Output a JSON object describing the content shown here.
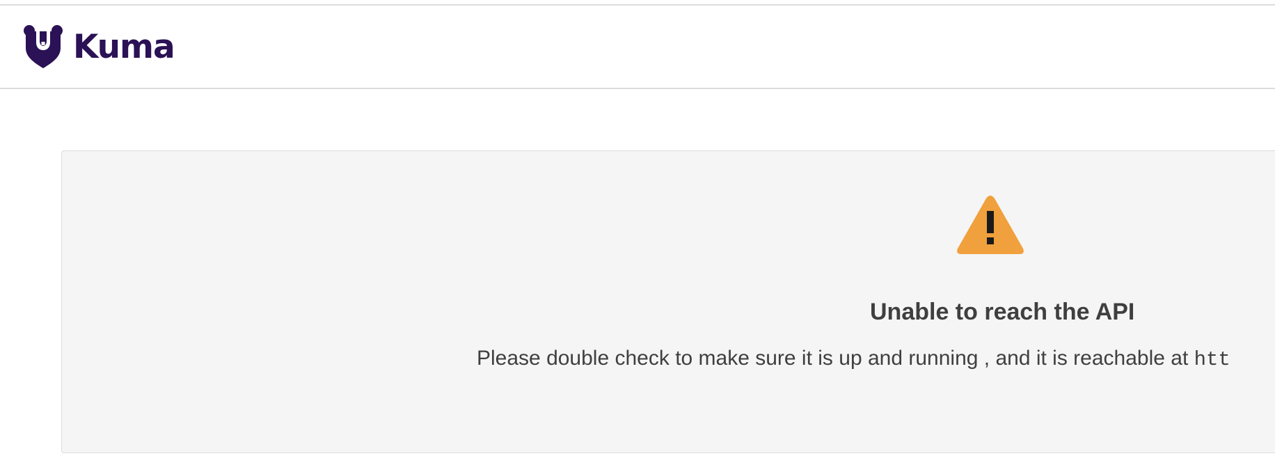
{
  "header": {
    "brand": "Kuma",
    "logo_icon": "bear-logo-icon",
    "brand_color": "#2b1155"
  },
  "error": {
    "icon": "warning-triangle-icon",
    "icon_color": "#f0a03c",
    "title": "Unable to reach the API",
    "message": "Please double check to make sure it is up and running , and it is reachable at ",
    "url": "htt"
  }
}
